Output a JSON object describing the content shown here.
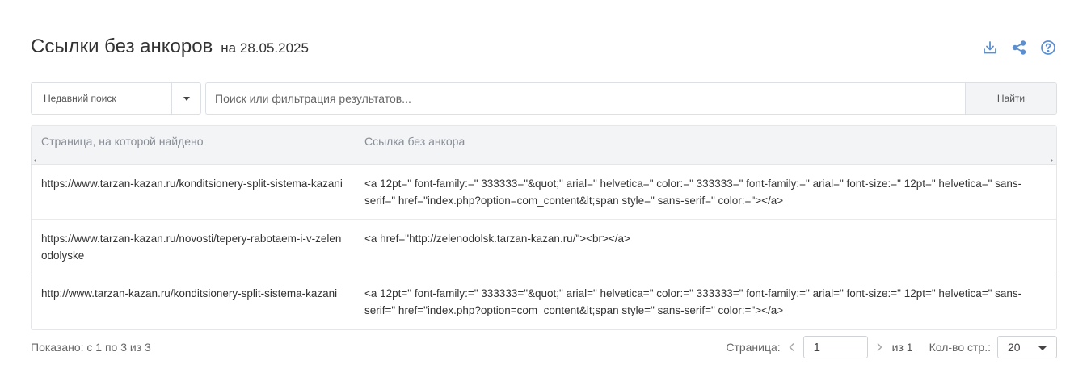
{
  "header": {
    "title": "Ссылки без анкоров",
    "subtitle": "на 28.05.2025",
    "icons": [
      "download-icon",
      "share-icon",
      "help-icon"
    ],
    "accent_color": "#5b8fd0"
  },
  "search": {
    "recent_label": "Недавний поиск",
    "placeholder": "Поиск или фильтрация результатов...",
    "find_label": "Найти"
  },
  "table": {
    "columns": [
      "Страница, на которой найдено",
      "Ссылка без анкора"
    ],
    "rows": [
      {
        "page": "https://www.tarzan-kazan.ru/konditsionery-split-sistema-kazani",
        "link": "<a 12pt=\" font-family:=\" 333333=\"&quot;\" arial=\" helvetica=\" color:=\" 333333=\" font-family:=\" arial=\" font-size:=\" 12pt=\" helvetica=\" sans-serif=\" href=\"index.php?option=com_content&lt;span style=\" sans-serif=\" color:=\"></a>"
      },
      {
        "page": "https://www.tarzan-kazan.ru/novosti/tepery-rabotaem-i-v-zelenodolyske",
        "link": "<a href=\"http://zelenodolsk.tarzan-kazan.ru/\"><br></a>"
      },
      {
        "page": "http://www.tarzan-kazan.ru/konditsionery-split-sistema-kazani",
        "link": "<a 12pt=\" font-family:=\" 333333=\"&quot;\" arial=\" helvetica=\" color:=\" 333333=\" font-family:=\" arial=\" font-size:=\" 12pt=\" helvetica=\" sans-serif=\" href=\"index.php?option=com_content&lt;span style=\" sans-serif=\" color:=\"></a>"
      }
    ]
  },
  "footer": {
    "shown": "Показано: с 1 по 3 из 3",
    "page_label": "Страница:",
    "page_value": "1",
    "of_label": "из 1",
    "per_page_label": "Кол-во стр.:",
    "per_page_value": "20"
  }
}
